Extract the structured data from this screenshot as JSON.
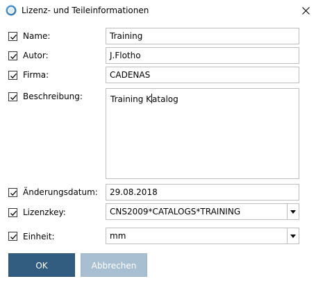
{
  "window": {
    "title": "Lizenz- und Teileinformationen",
    "close_icon": "close-icon",
    "app_icon": "app-logo-icon"
  },
  "fields": {
    "name": {
      "label": "Name:",
      "value": "Training",
      "checked": true
    },
    "autor": {
      "label": "Autor:",
      "value": "J.Flotho",
      "checked": true
    },
    "firma": {
      "label": "Firma:",
      "value": "CADENAS",
      "checked": true
    },
    "beschreibung": {
      "label": "Beschreibung:",
      "value_before_cursor": "Training K",
      "value_after_cursor": "atalog",
      "checked": true
    },
    "aenderungsdatum": {
      "label": "Änderungsdatum:",
      "value": "29.08.2018",
      "checked": true
    },
    "lizenzkey": {
      "label": "Lizenzkey:",
      "value": "CNS2009*CATALOGS*TRAINING",
      "checked": true
    },
    "einheit": {
      "label": "Einheit:",
      "value": "mm",
      "checked": true
    }
  },
  "buttons": {
    "ok": "OK",
    "cancel": "Abbrechen"
  },
  "colors": {
    "ok_button": "#325d81",
    "cancel_button_disabled": "#a8bfd2",
    "field_border": "#bdbdbd"
  }
}
